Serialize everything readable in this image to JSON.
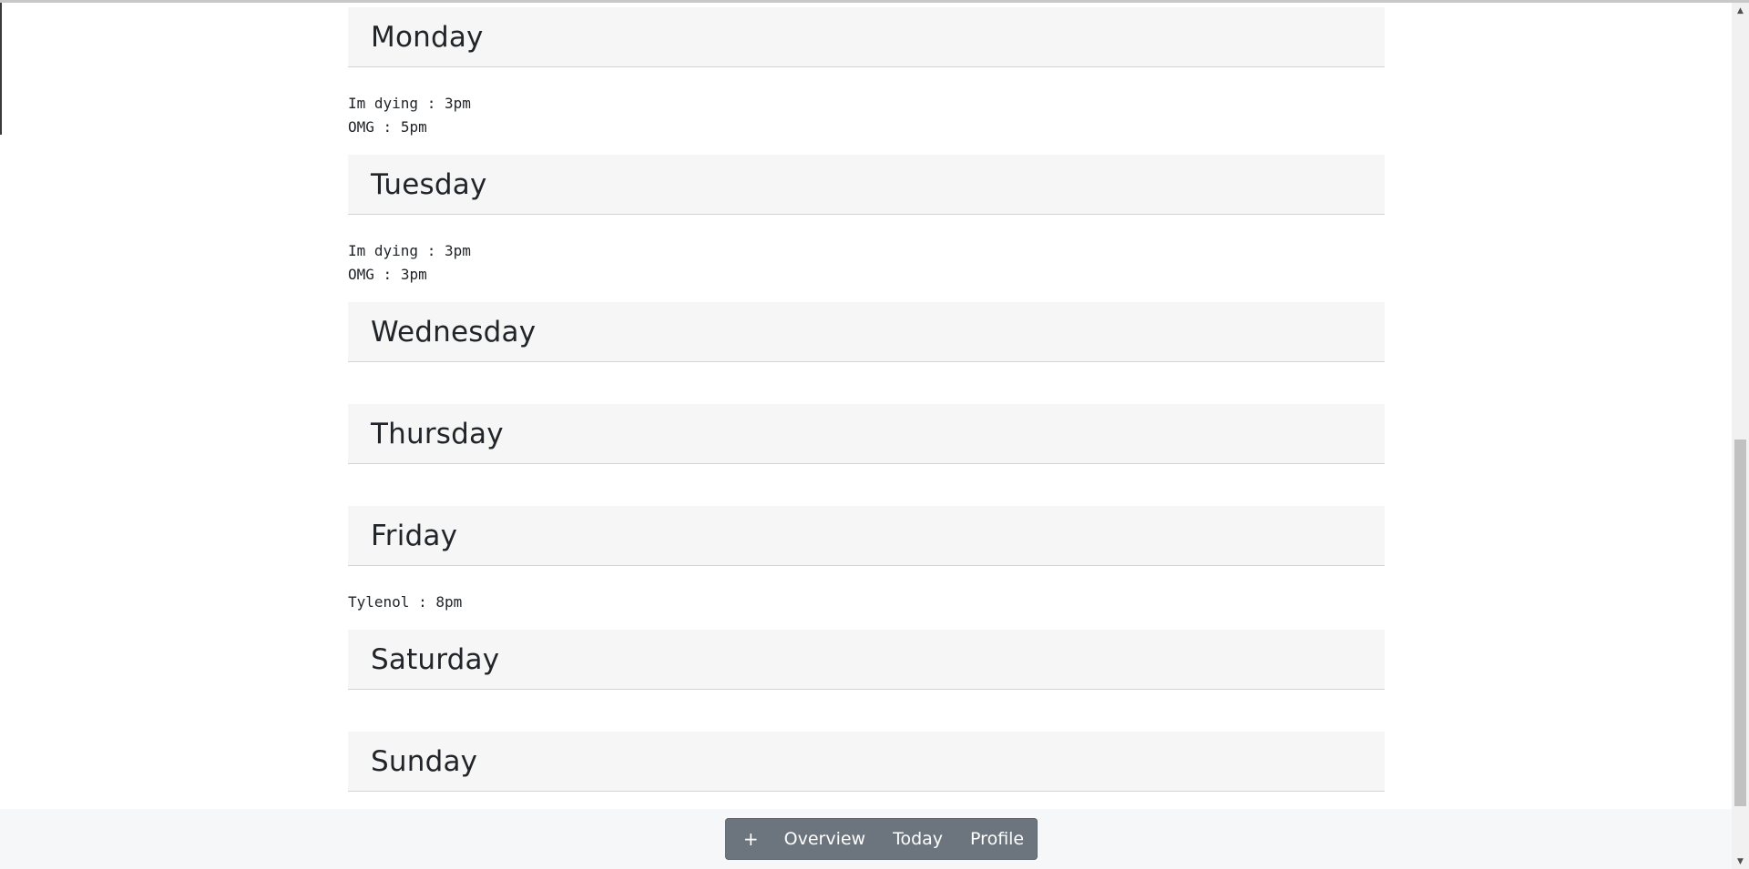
{
  "days": [
    {
      "name": "Monday",
      "meds": [
        {
          "name": "Im dying",
          "time": "3pm"
        },
        {
          "name": "OMG",
          "time": "5pm"
        }
      ]
    },
    {
      "name": "Tuesday",
      "meds": [
        {
          "name": "Im dying",
          "time": "3pm"
        },
        {
          "name": "OMG",
          "time": "3pm"
        }
      ]
    },
    {
      "name": "Wednesday",
      "meds": []
    },
    {
      "name": "Thursday",
      "meds": []
    },
    {
      "name": "Friday",
      "meds": [
        {
          "name": "Tylenol",
          "time": "8pm"
        }
      ]
    },
    {
      "name": "Saturday",
      "meds": []
    },
    {
      "name": "Sunday",
      "meds": []
    }
  ],
  "nav": {
    "add_label": "+",
    "overview_label": "Overview",
    "today_label": "Today",
    "profile_label": "Profile"
  },
  "icons": {
    "scroll_up": "triangle-up",
    "scroll_down": "triangle-down"
  }
}
